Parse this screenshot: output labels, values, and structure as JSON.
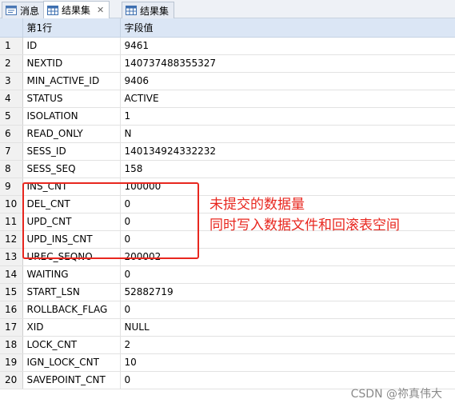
{
  "tabs": [
    {
      "label": "消息",
      "icon": "message-icon"
    },
    {
      "label": "结果集",
      "icon": "grid-icon",
      "close": "✕"
    },
    {
      "label": "结果集",
      "icon": "grid-icon"
    }
  ],
  "grid": {
    "columns": [
      "第1行",
      "字段值"
    ],
    "rows": [
      [
        "1",
        "ID",
        "9461"
      ],
      [
        "2",
        "NEXTID",
        "140737488355327"
      ],
      [
        "3",
        "MIN_ACTIVE_ID",
        "9406"
      ],
      [
        "4",
        "STATUS",
        "ACTIVE"
      ],
      [
        "5",
        "ISOLATION",
        "1"
      ],
      [
        "6",
        "READ_ONLY",
        "N"
      ],
      [
        "7",
        "SESS_ID",
        "140134924332232"
      ],
      [
        "8",
        "SESS_SEQ",
        "158"
      ],
      [
        "9",
        "INS_CNT",
        "100000"
      ],
      [
        "10",
        "DEL_CNT",
        "0"
      ],
      [
        "11",
        "UPD_CNT",
        "0"
      ],
      [
        "12",
        "UPD_INS_CNT",
        "0"
      ],
      [
        "13",
        "UREC_SEQNO",
        "200002"
      ],
      [
        "14",
        "WAITING",
        "0"
      ],
      [
        "15",
        "START_LSN",
        "52882719"
      ],
      [
        "16",
        "ROLLBACK_FLAG",
        "0"
      ],
      [
        "17",
        "XID",
        "NULL"
      ],
      [
        "18",
        "LOCK_CNT",
        "2"
      ],
      [
        "19",
        "IGN_LOCK_CNT",
        "10"
      ],
      [
        "20",
        "SAVEPOINT_CNT",
        "0"
      ]
    ]
  },
  "annotation": {
    "line1": "未提交的数据量",
    "line2": "同时写入数据文件和回滚表空间",
    "color": "#e8271f"
  },
  "watermark": "CSDN @祢真伟大"
}
